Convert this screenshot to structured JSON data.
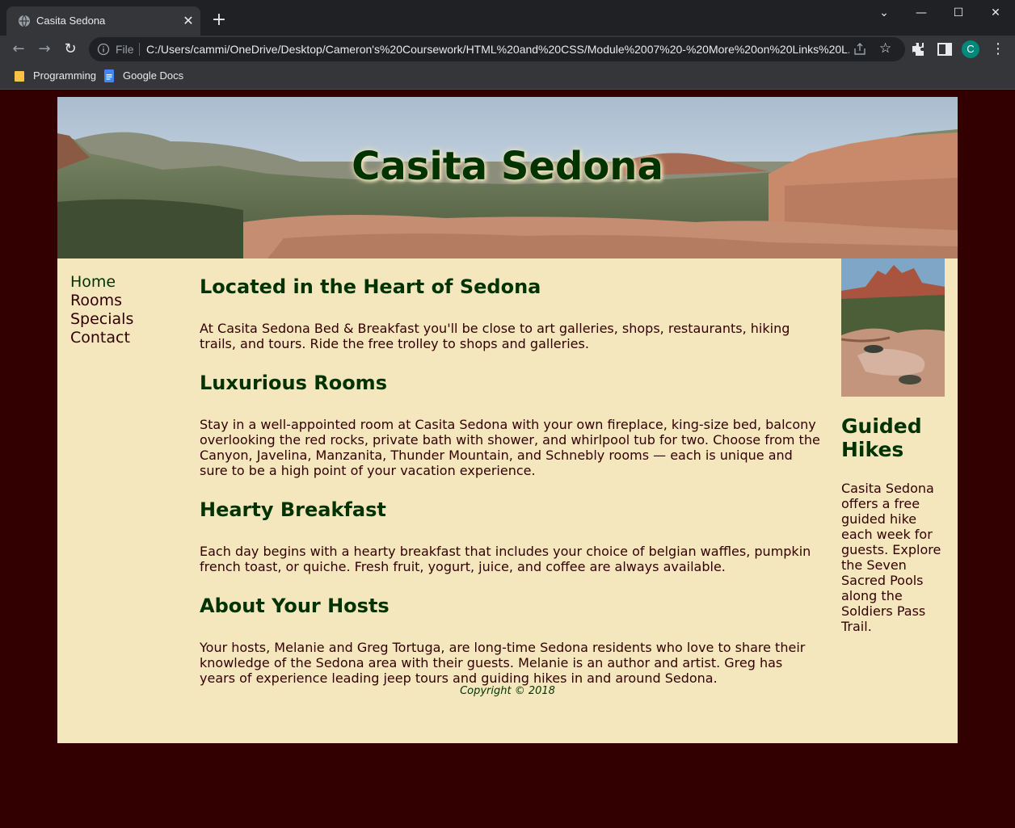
{
  "browser": {
    "tab_title": "Casita Sedona",
    "scheme_label": "File",
    "url": "C:/Users/cammi/OneDrive/Desktop/Cameron's%20Coursework/HTML%20and%20CSS/Module%2007%20-%20More%20on%20Links%20L...",
    "avatar_letter": "C",
    "bookmarks": [
      {
        "label": "Programming",
        "icon": "folder-icon"
      },
      {
        "label": "Google Docs",
        "icon": "google-docs-icon"
      }
    ]
  },
  "colors": {
    "page_bg": "#330000",
    "wrapper_bg": "#f5e7bd",
    "heading": "#003300",
    "text": "#330000"
  },
  "header": {
    "title": "Casita Sedona"
  },
  "nav": {
    "items": [
      {
        "label": "Home"
      },
      {
        "label": "Rooms"
      },
      {
        "label": "Specials"
      },
      {
        "label": "Contact"
      }
    ]
  },
  "main": {
    "sections": [
      {
        "heading": "Located in the Heart of Sedona",
        "text": "At Casita Sedona Bed & Breakfast you'll be close to art galleries, shops, restaurants, hiking trails, and tours. Ride the free trolley to shops and galleries."
      },
      {
        "heading": "Luxurious Rooms",
        "text": "Stay in a well-appointed room at Casita Sedona with your own fireplace, king-size bed, balcony overlooking the red rocks, private bath with shower, and whirlpool tub for two. Choose from the Canyon, Javelina, Manzanita, Thunder Mountain, and Schnebly rooms — each is unique and sure to be a high point of your vacation experience."
      },
      {
        "heading": "Hearty Breakfast",
        "text": "Each day begins with a hearty breakfast that includes your choice of belgian waffles, pumpkin french toast, or quiche. Fresh fruit, yogurt, juice, and coffee are always available."
      },
      {
        "heading": "About Your Hosts",
        "text": "Your hosts, Melanie and Greg Tortuga, are long-time Sedona residents who love to share their knowledge of the Sedona area with their guests. Melanie is an author and artist. Greg has years of experience leading jeep tours and guiding hikes in and around Sedona."
      }
    ]
  },
  "aside": {
    "heading": "Guided Hikes",
    "text": "Casita Sedona offers a free guided hike each week for guests. Explore the Seven Sacred Pools along the Soldiers Pass Trail."
  },
  "footer": {
    "copyright": "Copyright © 2018"
  }
}
